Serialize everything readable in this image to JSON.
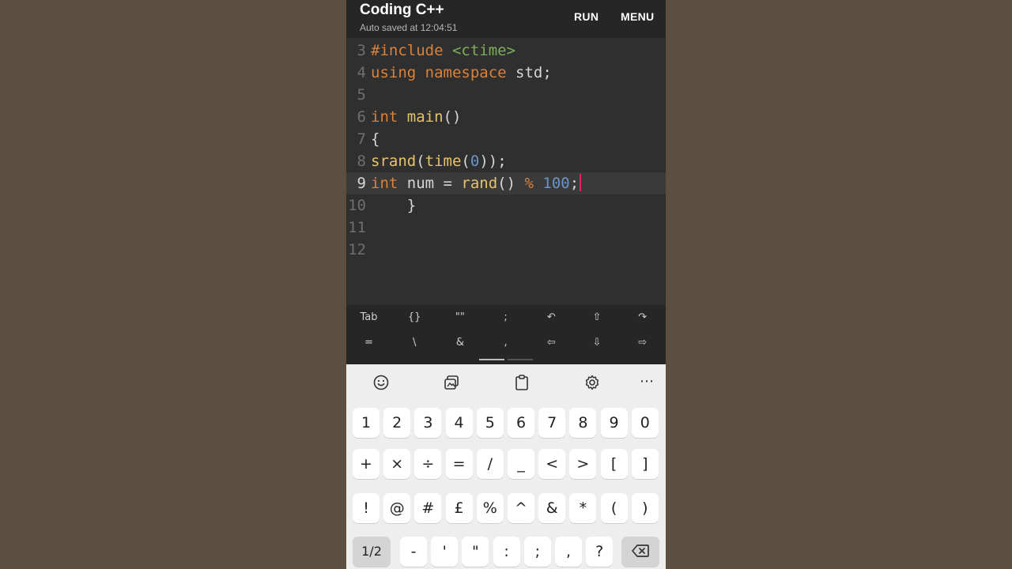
{
  "app": {
    "title": "Coding C++",
    "subtitle": "Auto saved at 12:04:51",
    "run_label": "RUN",
    "menu_label": "MENU"
  },
  "editor": {
    "active_line": "9",
    "lines": [
      {
        "num": "3",
        "tokens": [
          {
            "t": "#include ",
            "c": "kw"
          },
          {
            "t": "<ctime>",
            "c": "str"
          }
        ]
      },
      {
        "num": "4",
        "tokens": [
          {
            "t": "using ",
            "c": "kw"
          },
          {
            "t": "namespace ",
            "c": "kw"
          },
          {
            "t": "std;",
            "c": "plain"
          }
        ]
      },
      {
        "num": "5",
        "tokens": []
      },
      {
        "num": "6",
        "tokens": [
          {
            "t": "int ",
            "c": "kw"
          },
          {
            "t": "main",
            "c": "fn"
          },
          {
            "t": "()",
            "c": "plain"
          }
        ]
      },
      {
        "num": "7",
        "tokens": [
          {
            "t": "{",
            "c": "plain"
          }
        ]
      },
      {
        "num": "8",
        "tokens": [
          {
            "t": "srand",
            "c": "fn"
          },
          {
            "t": "(",
            "c": "plain"
          },
          {
            "t": "time",
            "c": "fn"
          },
          {
            "t": "(",
            "c": "plain"
          },
          {
            "t": "0",
            "c": "num"
          },
          {
            "t": "));",
            "c": "plain"
          }
        ]
      },
      {
        "num": "9",
        "tokens": [
          {
            "t": "int ",
            "c": "kw"
          },
          {
            "t": "num = ",
            "c": "plain"
          },
          {
            "t": "rand",
            "c": "fn"
          },
          {
            "t": "() ",
            "c": "plain"
          },
          {
            "t": "% ",
            "c": "op"
          },
          {
            "t": "100",
            "c": "num"
          },
          {
            "t": ";",
            "c": "plain"
          }
        ]
      },
      {
        "num": "10",
        "tokens": [
          {
            "t": "    }",
            "c": "plain"
          }
        ]
      },
      {
        "num": "11",
        "tokens": []
      },
      {
        "num": "12",
        "tokens": []
      }
    ]
  },
  "extra_keys": {
    "row1": [
      {
        "label": "Tab",
        "name": "tab-key"
      },
      {
        "label": "{}",
        "name": "braces-key"
      },
      {
        "label": "\"\"",
        "name": "quotes-key"
      },
      {
        "label": ";",
        "name": "semicolon-key"
      },
      {
        "label": "↶",
        "name": "undo-key"
      },
      {
        "label": "⇧",
        "name": "shift-key"
      },
      {
        "label": "↷",
        "name": "redo-key"
      }
    ],
    "row2": [
      {
        "label": "=",
        "name": "equals-key"
      },
      {
        "label": "\\",
        "name": "backslash-key"
      },
      {
        "label": "&",
        "name": "ampersand-key"
      },
      {
        "label": ",",
        "name": "comma-key"
      },
      {
        "label": "⇦",
        "name": "arrow-left-key"
      },
      {
        "label": "⇩",
        "name": "arrow-down-key"
      },
      {
        "label": "⇨",
        "name": "arrow-right-key"
      }
    ]
  },
  "keyboard": {
    "toolbar_icons": [
      "emoji-icon",
      "sticker-icon",
      "clipboard-icon",
      "settings-icon",
      "more-icon"
    ],
    "more_label": "⋯",
    "row1": [
      "1",
      "2",
      "3",
      "4",
      "5",
      "6",
      "7",
      "8",
      "9",
      "0"
    ],
    "row2": [
      "+",
      "×",
      "÷",
      "=",
      "/",
      "_",
      "<",
      ">",
      "[",
      "]"
    ],
    "row3": [
      "!",
      "@",
      "#",
      "£",
      "%",
      "^",
      "&",
      "*",
      "(",
      ")"
    ],
    "row4": [
      "-",
      "'",
      "\"",
      ":",
      ";",
      ",",
      "?"
    ],
    "page_toggle": "1/2",
    "backspace_icon": "backspace-icon"
  },
  "colors": {
    "keyword": "#d9823b",
    "function": "#e5c36e",
    "string": "#7fae5a",
    "number": "#6a95c8",
    "cursor": "#e0246a"
  }
}
